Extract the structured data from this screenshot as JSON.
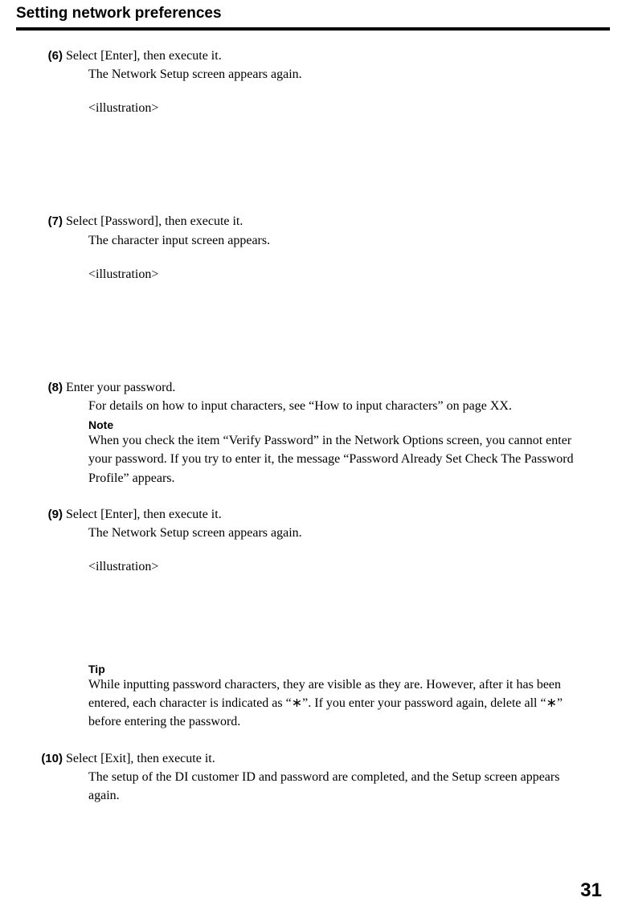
{
  "header": {
    "title": "Setting network preferences"
  },
  "steps": {
    "s6": {
      "num": "(6)",
      "line1": "Select [Enter], then execute it.",
      "line2": "The Network Setup screen appears again.",
      "illustration": "<illustration>"
    },
    "s7": {
      "num": "(7)",
      "line1": "Select [Password], then execute it.",
      "line2": "The character input screen appears.",
      "illustration": "<illustration>"
    },
    "s8": {
      "num": "(8)",
      "line1": "Enter your password.",
      "line2": "For details on how to input characters, see “How to input characters” on page XX.",
      "note_label": "Note",
      "note_body": "When you check the item “Verify Password” in the Network Options screen, you cannot enter your password. If you try to enter it, the message “Password Already Set Check The Password Profile” appears."
    },
    "s9": {
      "num": "(9)",
      "line1": "Select [Enter], then execute it.",
      "line2": "The Network Setup screen appears again.",
      "illustration": "<illustration>",
      "tip_label": "Tip",
      "tip_body": "While inputting password characters, they are visible as they are. However, after it has been entered, each character is indicated as “∗”. If you enter your password again, delete all “∗” before entering the password."
    },
    "s10": {
      "num": "(10)",
      "line1": "Select [Exit], then execute it.",
      "line2": "The setup of the DI customer ID and password are completed, and the Setup screen appears again."
    }
  },
  "page_number": "31"
}
